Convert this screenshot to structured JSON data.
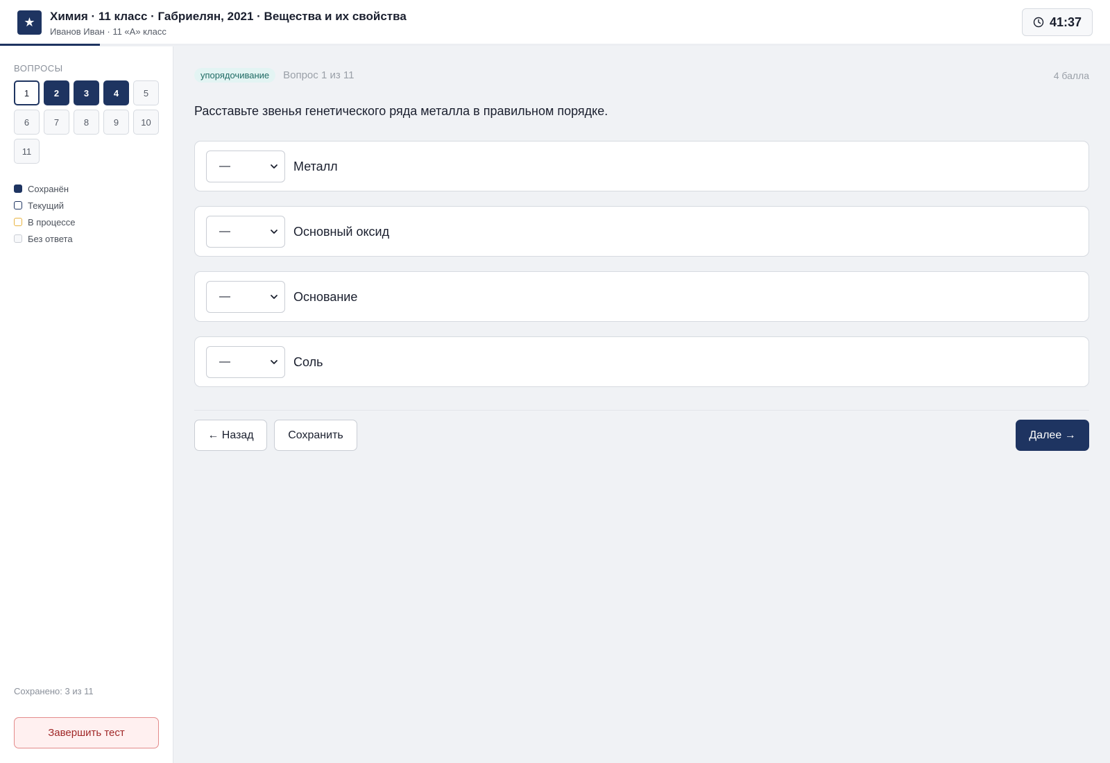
{
  "header": {
    "logo_glyph": "★",
    "title": "Химия · 11 класс · Габриелян, 2021 · Вещества и их свойства",
    "subtitle": "Иванов Иван · 11 «А» класс",
    "progress_fraction": 0.09,
    "timer": "41:37"
  },
  "sidebar": {
    "section_title": "ВОПРОСЫ",
    "questions": [
      {
        "n": "1",
        "state": "current"
      },
      {
        "n": "2",
        "state": "saved"
      },
      {
        "n": "3",
        "state": "saved"
      },
      {
        "n": "4",
        "state": "saved"
      },
      {
        "n": "5",
        "state": "empty"
      },
      {
        "n": "6",
        "state": "empty"
      },
      {
        "n": "7",
        "state": "empty"
      },
      {
        "n": "8",
        "state": "empty"
      },
      {
        "n": "9",
        "state": "empty"
      },
      {
        "n": "10",
        "state": "empty"
      },
      {
        "n": "11",
        "state": "empty"
      }
    ],
    "legend": [
      {
        "label": "Сохранён",
        "state": "saved"
      },
      {
        "label": "Текущий",
        "state": "current"
      },
      {
        "label": "В процессе",
        "state": "progress"
      },
      {
        "label": "Без ответа",
        "state": "empty"
      }
    ],
    "saved_count": "Сохранено: 3 из 11",
    "finish_label": "Завершить тест"
  },
  "question": {
    "type_badge": "упорядочивание",
    "number": "Вопрос 1 из 11",
    "points": "4 балла",
    "text": "Расставьте звенья генетического ряда металла в правильном порядке.",
    "items": [
      {
        "select_value": "—",
        "label": "Металл"
      },
      {
        "select_value": "—",
        "label": "Основный оксид"
      },
      {
        "select_value": "—",
        "label": "Основание"
      },
      {
        "select_value": "—",
        "label": "Соль"
      }
    ]
  },
  "nav": {
    "back_label": "← Назад",
    "save_label": "Сохранить",
    "next_label": "Далее →"
  },
  "colors": {
    "primary": "#1e3461",
    "badge_bg": "#e3f4f3",
    "badge_text": "#1f6b64",
    "danger": "#a02828",
    "in_progress": "#e8b340"
  }
}
